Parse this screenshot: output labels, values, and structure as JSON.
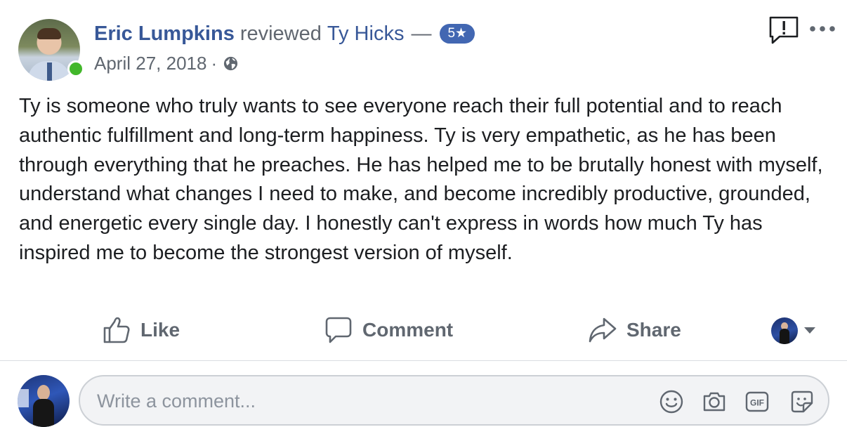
{
  "post": {
    "author_name": "Eric Lumpkins",
    "action_text": "reviewed",
    "target_name": "Ty Hicks",
    "dash": "—",
    "rating": "5★",
    "date": "April 27, 2018",
    "separator": "·",
    "privacy_icon": "globe-icon",
    "online_color": "#42b72a",
    "review_text": "Ty is someone who truly wants to see everyone reach their full potential and to reach authentic fulfillment and long-term happiness. Ty is very empathetic, as he has been through everything that he preaches. He has helped me to be brutally honest with myself, understand what changes I need to make, and become incredibly productive, grounded, and energetic every single day. I honestly can't express in words how much Ty has inspired me to become the strongest version of myself."
  },
  "header_icons": {
    "report": "report-icon",
    "more": "more-icon"
  },
  "actions": {
    "like_label": "Like",
    "comment_label": "Comment",
    "share_label": "Share",
    "like_icon": "thumbs-up-icon",
    "comment_icon": "speech-bubble-icon",
    "share_icon": "share-arrow-icon"
  },
  "composer": {
    "placeholder": "Write a comment...",
    "value": "",
    "tools": [
      "emoji-icon",
      "camera-icon",
      "gif-icon",
      "sticker-icon"
    ]
  },
  "colors": {
    "link_blue": "#385898",
    "badge_blue": "#4267b2",
    "secondary_text": "#606770",
    "body_text": "#1c1e21"
  }
}
